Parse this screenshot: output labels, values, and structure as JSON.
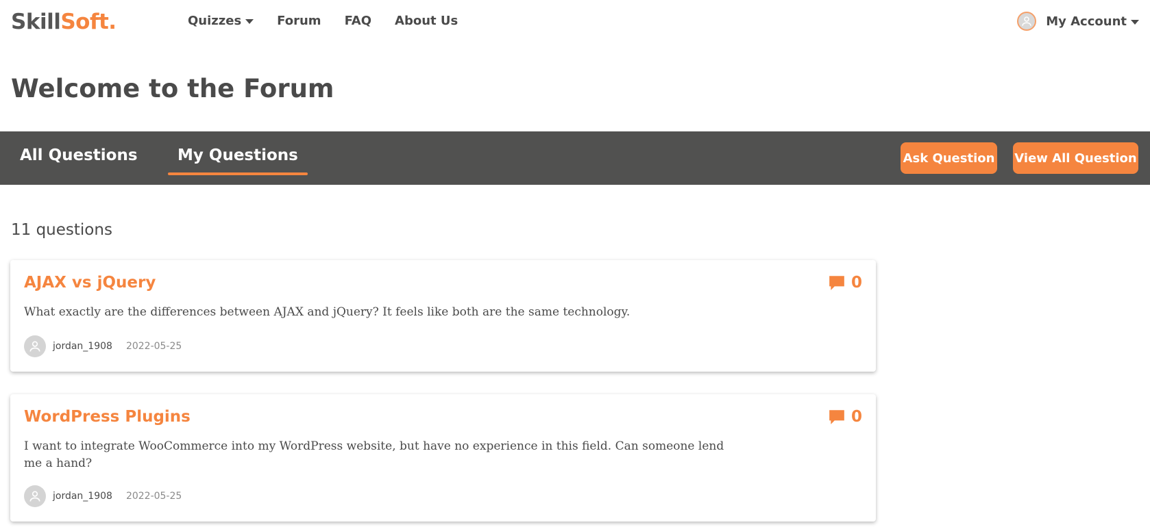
{
  "brand": {
    "part1": "Skill",
    "part2": "Soft."
  },
  "nav": {
    "items": [
      {
        "label": "Quizzes",
        "has_dropdown": true
      },
      {
        "label": "Forum"
      },
      {
        "label": "FAQ"
      },
      {
        "label": "About Us"
      }
    ]
  },
  "account": {
    "label": "My Account"
  },
  "page": {
    "title": "Welcome to the Forum"
  },
  "tabs": {
    "all": "All Questions",
    "my": "My Questions",
    "active": "my"
  },
  "actions": {
    "ask": "Ask Question",
    "view_all": "View All Question"
  },
  "list": {
    "count_label": "11 questions",
    "questions": [
      {
        "title": "AJAX vs jQuery",
        "body": "What exactly are the differences between AJAX and jQuery? It feels like both are the same technology.",
        "comments": "0",
        "user": "jordan_1908",
        "date": "2022-05-25"
      },
      {
        "title": "WordPress Plugins",
        "body": "I want to integrate WooCommerce into my WordPress website, but have no experience in this field. Can someone lend me a hand?",
        "comments": "0",
        "user": "jordan_1908",
        "date": "2022-05-25"
      }
    ]
  },
  "colors": {
    "accent": "#f5853f",
    "tabbar": "#515150",
    "text": "#4a4a4a"
  }
}
